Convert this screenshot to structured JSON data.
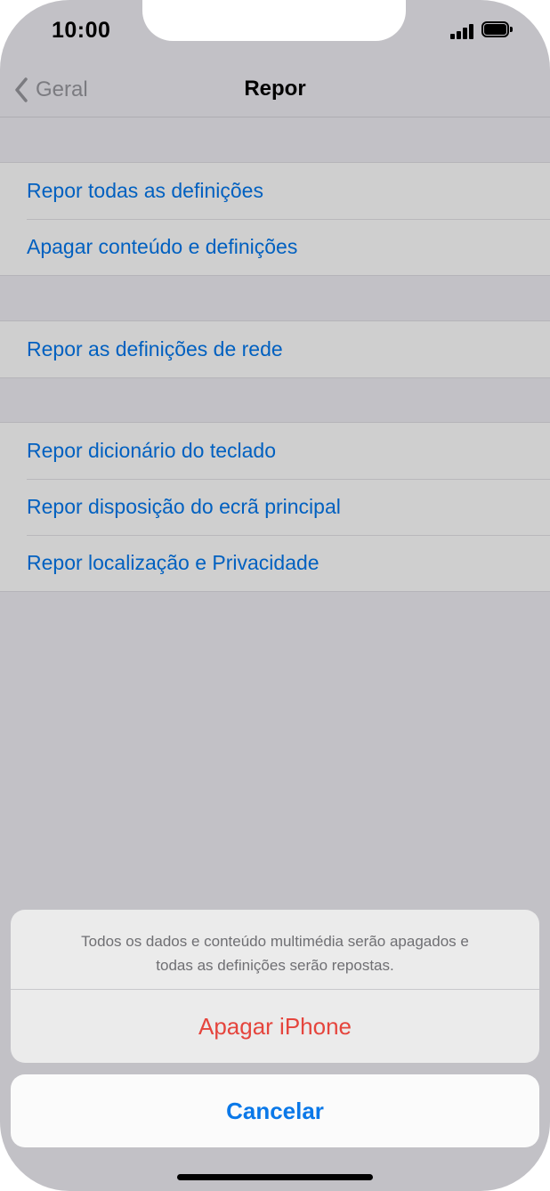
{
  "status_bar": {
    "time": "10:00",
    "signal_icon": "cellular-signal-icon",
    "battery_icon": "battery-full-icon"
  },
  "nav": {
    "back_label": "Geral",
    "back_icon": "chevron-left-icon",
    "title": "Repor"
  },
  "groups": [
    {
      "items": [
        {
          "label": "Repor todas as definições"
        },
        {
          "label": "Apagar conteúdo e definições"
        }
      ]
    },
    {
      "items": [
        {
          "label": "Repor as definições de rede"
        }
      ]
    },
    {
      "items": [
        {
          "label": "Repor dicionário do teclado"
        },
        {
          "label": "Repor disposição do ecrã principal"
        },
        {
          "label": "Repor localização e Privacidade"
        }
      ]
    }
  ],
  "action_sheet": {
    "message_line1": "Todos os dados e conteúdo multimédia serão apagados e",
    "message_line2": "todas as definições serão repostas.",
    "destructive_label": "Apagar iPhone",
    "cancel_label": "Cancelar"
  },
  "colors": {
    "link_blue": "#0060c0",
    "destructive_red": "#e5453d",
    "cancel_blue": "#0a78e8",
    "dimmed_background": "#c2c1c6"
  }
}
